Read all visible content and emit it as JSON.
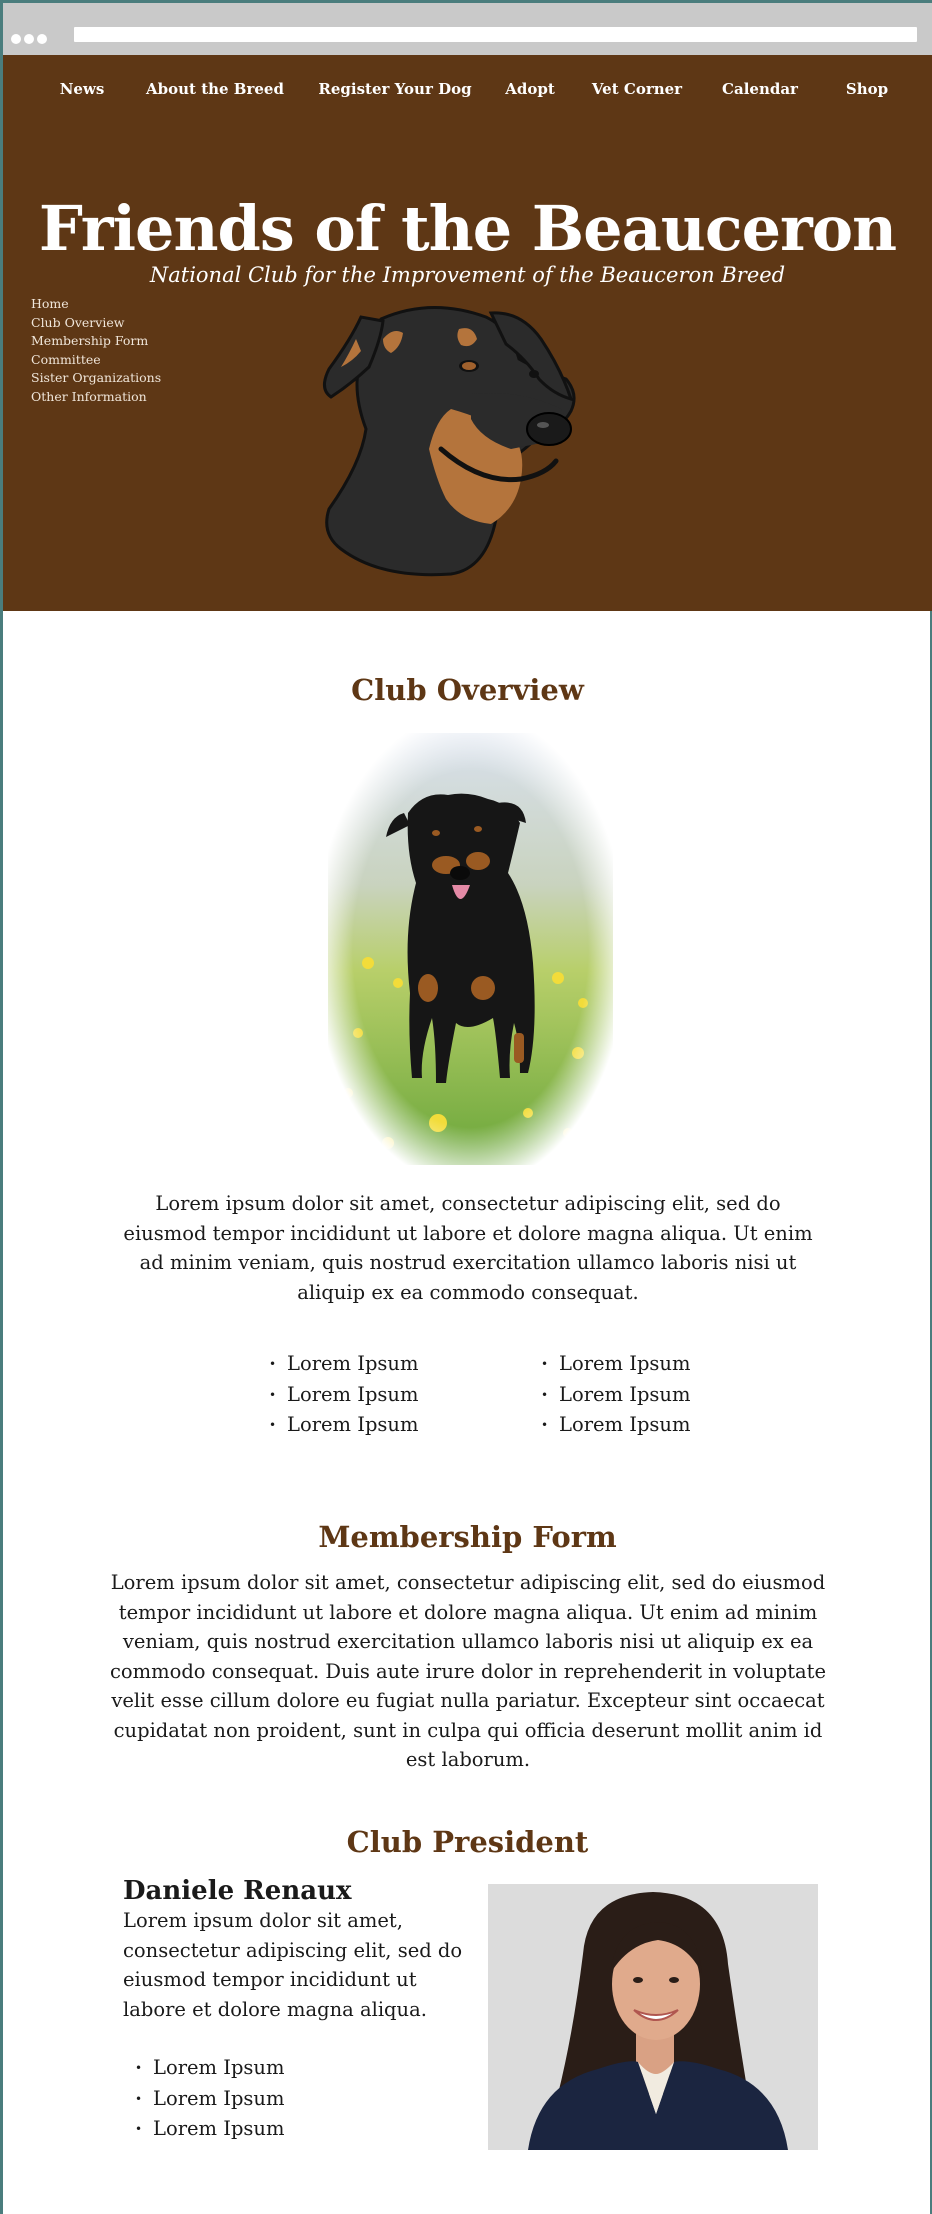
{
  "nav": {
    "top": [
      "News",
      "About the Breed",
      "Register Your Dog",
      "Adopt",
      "Vet Corner",
      "Calendar",
      "Shop"
    ],
    "side": [
      "Home",
      "Club Overview",
      "Membership Form",
      "Committee",
      "Sister Organizations",
      "Other Information"
    ]
  },
  "header": {
    "title": "Friends of the Beauceron",
    "subtitle": "National Club for the Improvement of the Beauceron Breed"
  },
  "overview": {
    "heading": "Club Overview",
    "paragraph": "Lorem ipsum dolor sit amet, consectetur adipiscing elit, sed do eiusmod tempor incididunt ut labore et dolore magna aliqua. Ut enim ad minim veniam, quis nostrud exercitation ullamco laboris nisi ut aliquip ex ea commodo consequat.",
    "list_left": [
      "Lorem Ipsum",
      "Lorem Ipsum",
      "Lorem Ipsum"
    ],
    "list_right": [
      "Lorem Ipsum",
      "Lorem Ipsum",
      "Lorem Ipsum"
    ]
  },
  "membership": {
    "heading": "Membership Form",
    "paragraph": "Lorem ipsum dolor sit amet, consectetur adipiscing elit, sed do eiusmod tempor incididunt ut labore et dolore magna aliqua. Ut enim ad minim veniam, quis nostrud exercitation ullamco laboris nisi ut aliquip ex ea commodo consequat. Duis aute irure dolor in reprehenderit in voluptate velit esse cillum dolore eu fugiat nulla pariatur. Excepteur sint occaecat cupidatat non proident, sunt in culpa qui officia deserunt mollit anim id est laborum."
  },
  "president": {
    "heading": "Club President",
    "name": "Daniele Renaux",
    "bio": "Lorem ipsum dolor sit amet, consectetur adipiscing elit, sed do eiusmod tempor incididunt ut labore et dolore magna aliqua.",
    "list": [
      "Lorem Ipsum",
      "Lorem Ipsum",
      "Lorem Ipsum"
    ]
  },
  "colors": {
    "brand": "#5e3715",
    "accent": "#b4743c",
    "frame": "#4a7d7d"
  }
}
